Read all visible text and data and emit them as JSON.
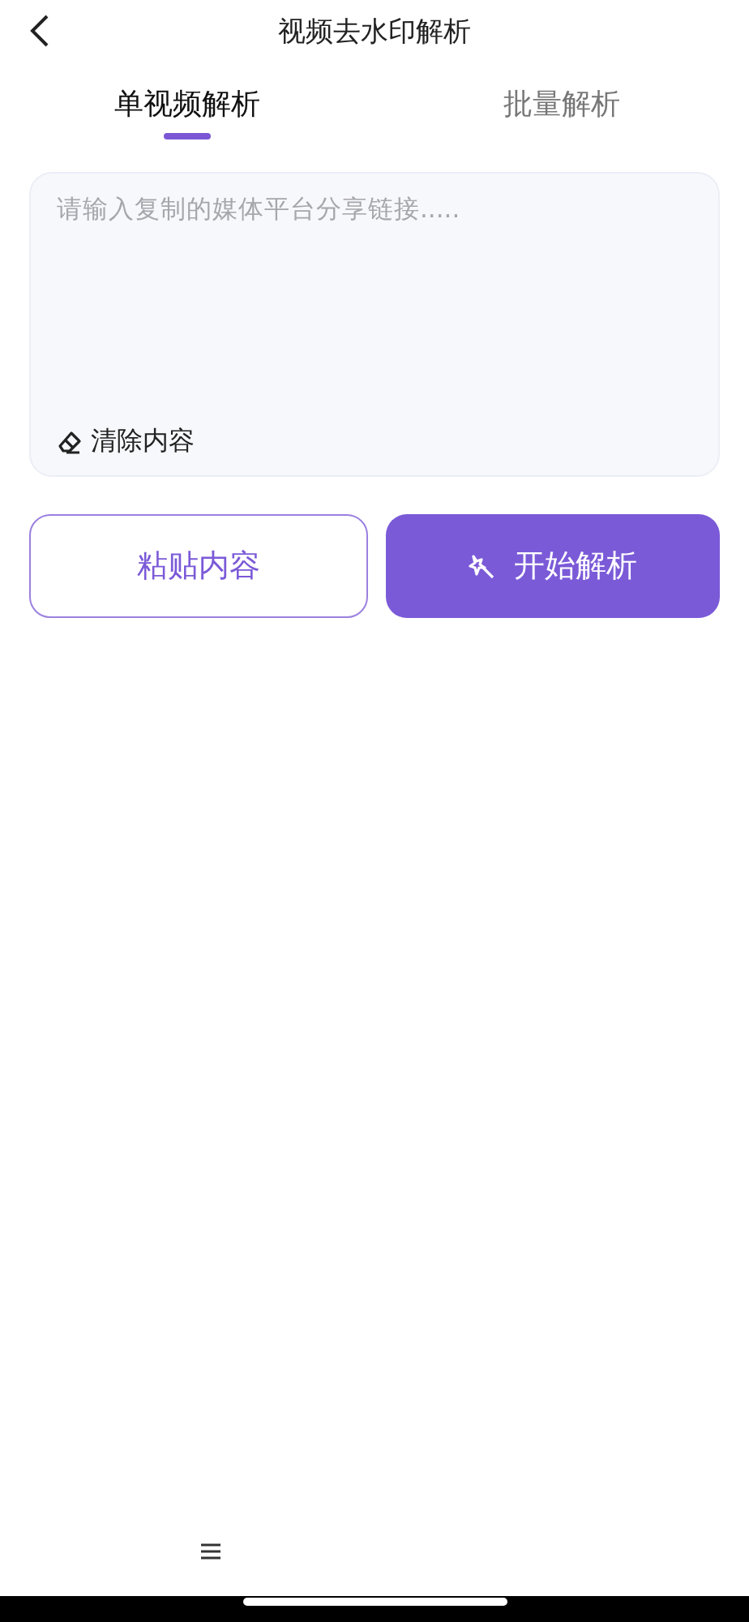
{
  "header": {
    "title": "视频去水印解析"
  },
  "tabs": [
    {
      "label": "单视频解析",
      "selected": true
    },
    {
      "label": "批量解析",
      "selected": false
    }
  ],
  "input": {
    "placeholder": "请输入复制的媒体平台分享链接.....",
    "clear_label": "清除内容"
  },
  "buttons": [
    {
      "kind": "outline",
      "label": "粘贴内容"
    },
    {
      "kind": "primary",
      "label": "开始解析"
    }
  ]
}
